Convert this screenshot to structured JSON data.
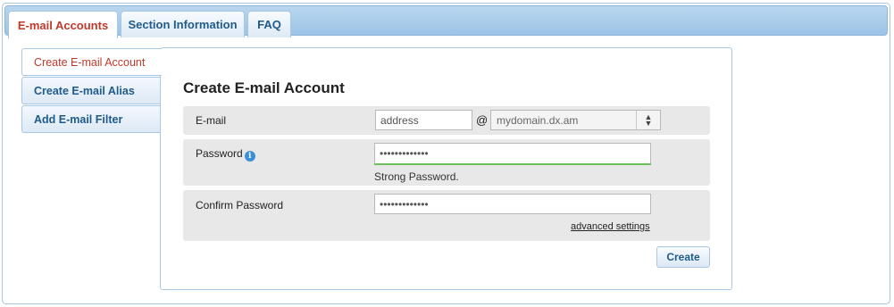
{
  "tabs": [
    {
      "label": "E-mail Accounts"
    },
    {
      "label": "Section Information"
    },
    {
      "label": "FAQ"
    }
  ],
  "sidebar": {
    "items": [
      {
        "label": "Create E-mail Account"
      },
      {
        "label": "Create E-mail Alias"
      },
      {
        "label": "Add E-mail Filter"
      }
    ]
  },
  "form": {
    "title": "Create E-mail Account",
    "email_label": "E-mail",
    "email_value": "address",
    "at_symbol": "@",
    "domain_value": "mydomain.dx.am",
    "password_label": "Password",
    "password_value": "•••••••••••••",
    "password_strength": "Strong Password.",
    "confirm_label": "Confirm Password",
    "confirm_value": "•••••••••••••",
    "advanced_link": "advanced settings",
    "create_button": "Create"
  },
  "colors": {
    "active_tab_text": "#c0392b",
    "tab_text": "#1f5a8a",
    "strength_bar": "#6cbf5a"
  }
}
